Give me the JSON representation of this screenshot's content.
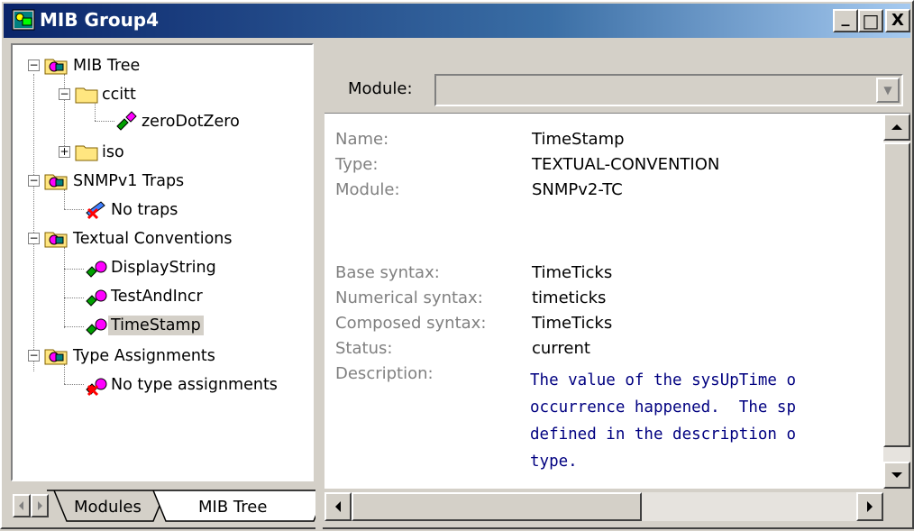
{
  "window": {
    "title": "MIB Group4",
    "buttons": {
      "minimize": "_",
      "maximize": "□",
      "close": "X"
    }
  },
  "tree": {
    "nodes": [
      {
        "label": "MIB Tree",
        "icon": "folder-group-icon",
        "expander": "−"
      },
      {
        "label": "ccitt",
        "icon": "folder-icon",
        "expander": "−"
      },
      {
        "label": "zeroDotZero",
        "icon": "object-identifier-icon"
      },
      {
        "label": "iso",
        "icon": "folder-icon",
        "expander": "+"
      },
      {
        "label": "SNMPv1 Traps",
        "icon": "folder-group-icon",
        "expander": "−"
      },
      {
        "label": "No traps",
        "icon": "no-trap-icon"
      },
      {
        "label": "Textual Conventions",
        "icon": "folder-group-icon",
        "expander": "−"
      },
      {
        "label": "DisplayString",
        "icon": "textual-convention-icon"
      },
      {
        "label": "TestAndIncr",
        "icon": "textual-convention-icon"
      },
      {
        "label": "TimeStamp",
        "icon": "textual-convention-icon",
        "selected": true
      },
      {
        "label": "Type Assignments",
        "icon": "folder-group-icon",
        "expander": "−"
      },
      {
        "label": "No type assignments",
        "icon": "no-type-icon"
      }
    ]
  },
  "tabs": [
    {
      "label": "Modules",
      "active": false
    },
    {
      "label": "MIB Tree",
      "active": true
    }
  ],
  "module_bar": {
    "label": "Module:",
    "value": ""
  },
  "details": {
    "rows": [
      {
        "label": "Name:",
        "value": "TimeStamp"
      },
      {
        "label": "Type:",
        "value": "TEXTUAL-CONVENTION"
      },
      {
        "label": "Module:",
        "value": "SNMPv2-TC"
      },
      {
        "label": "Base syntax:",
        "value": "TimeTicks"
      },
      {
        "label": "Numerical syntax:",
        "value": "timeticks"
      },
      {
        "label": "Composed syntax:",
        "value": "TimeTicks"
      },
      {
        "label": "Status:",
        "value": "current"
      }
    ],
    "description_label": "Description:",
    "description_lines": [
      "The value of the sysUpTime o",
      "occurrence happened.  The sp",
      "defined in the description o",
      "type."
    ]
  },
  "colors": {
    "title_start": "#0a246a",
    "title_end": "#a6caf0",
    "description_text": "#000080",
    "label_gray": "#808080"
  }
}
